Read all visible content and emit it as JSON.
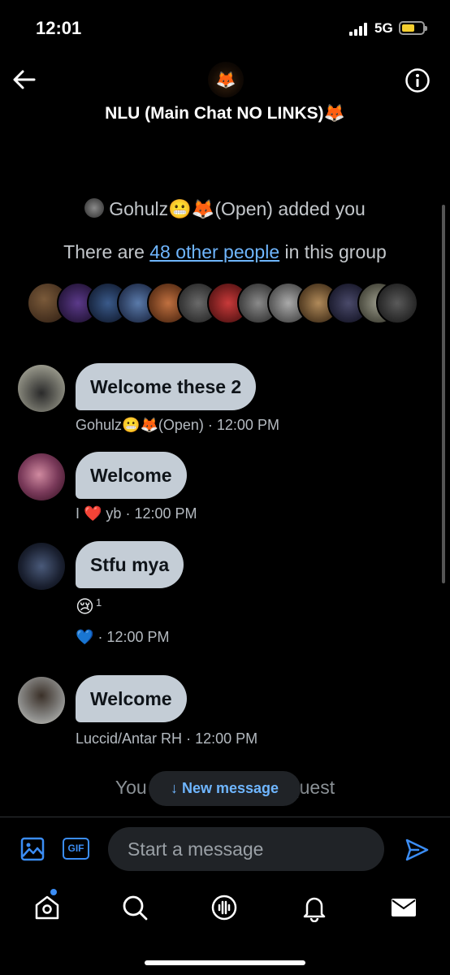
{
  "status_bar": {
    "time": "12:01",
    "network": "5G"
  },
  "header": {
    "title": "NLU (Main Chat NO LINKS)🦊"
  },
  "system": {
    "added_text": "Gohulz😬🦊(Open) added you",
    "count_prefix": "There are ",
    "count_link": "48 other people",
    "count_suffix": " in this group"
  },
  "messages": [
    {
      "text": "Welcome these 2",
      "sender": "Gohulz😬🦊(Open)",
      "time": "· 12:00 PM"
    },
    {
      "text": "Welcome",
      "sender": "I ❤️ yb",
      "time": "· 12:00 PM"
    },
    {
      "text": "Stfu mya",
      "reaction_emoji": "😢",
      "reaction_count": "1",
      "heart": "💙",
      "time": "· 12:00 PM"
    },
    {
      "text": "Welcome",
      "sender": "Luccid/Antar RH",
      "time": "· 12:00 PM"
    }
  ],
  "under_text": "You are in a group request",
  "new_message": "↓ New message",
  "composer": {
    "placeholder": "Start a message",
    "gif_label": "GIF"
  },
  "colors": {
    "accent": "#3b8df5",
    "link": "#6fb6ff",
    "bubble": "#c4cdd6",
    "background": "#000000"
  },
  "icons": [
    "back-arrow-icon",
    "info-icon",
    "image-icon",
    "gif-icon",
    "send-icon",
    "home-icon",
    "search-icon",
    "spaces-icon",
    "bell-icon",
    "mail-icon"
  ]
}
